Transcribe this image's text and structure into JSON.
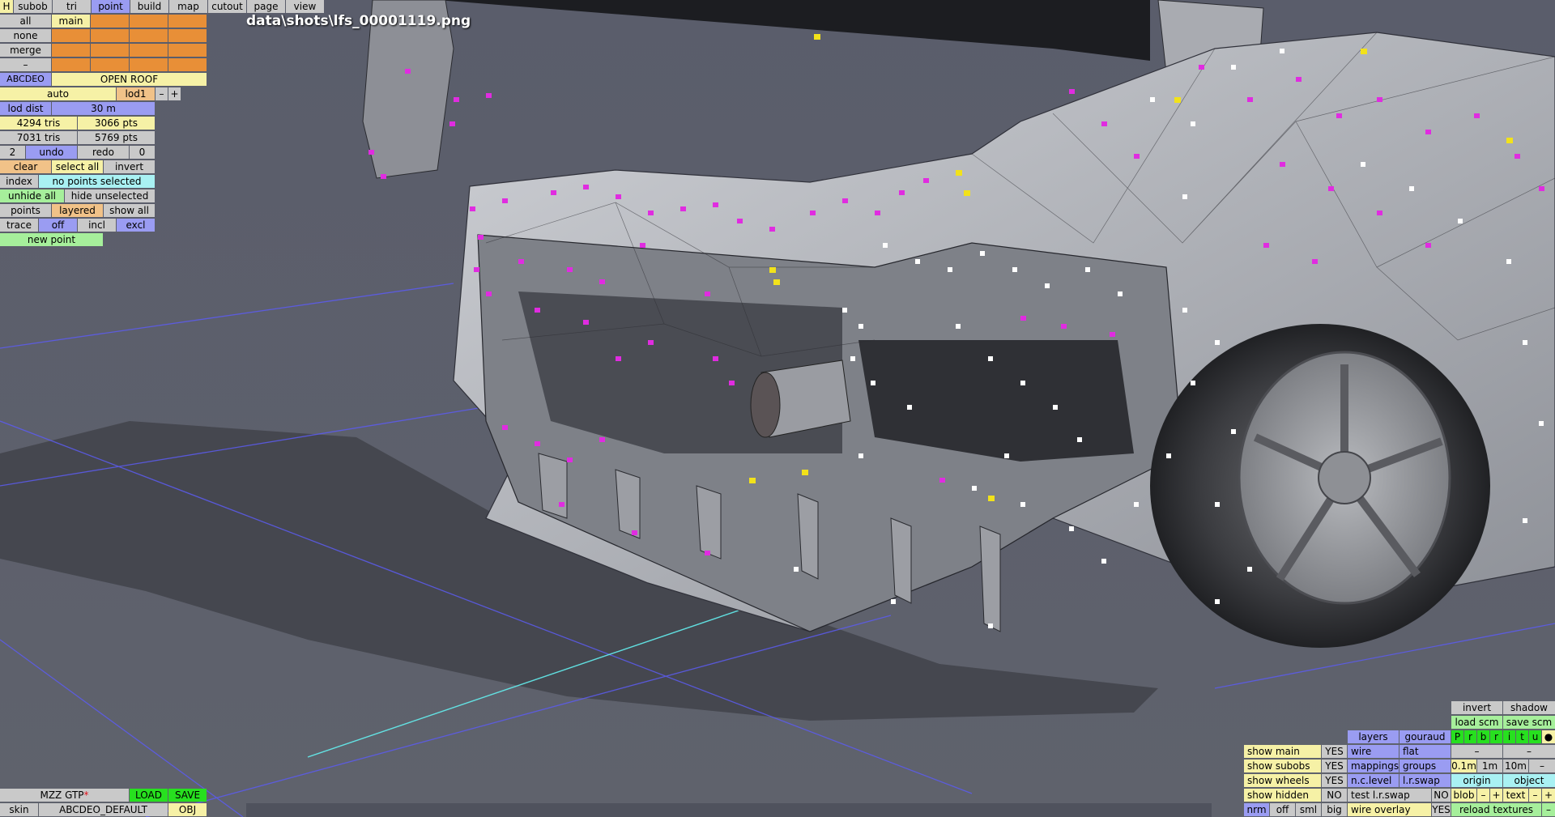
{
  "menu": {
    "h": "H",
    "tabs": [
      "subob",
      "tri",
      "point",
      "build",
      "map",
      "cutout",
      "page",
      "view"
    ],
    "active": "point"
  },
  "select": {
    "all": "all",
    "main": "main",
    "none": "none",
    "merge": "merge",
    "minus": "–"
  },
  "roof": {
    "code": "ABCDEO",
    "label": "OPEN ROOF"
  },
  "lod": {
    "mode": "auto",
    "level": "lod1",
    "dec": "–",
    "inc": "+",
    "dist_label": "lod dist",
    "dist_value": "30 m"
  },
  "stats": {
    "tris_a": "4294 tris",
    "pts_a": "3066 pts",
    "tris_b": "7031 tris",
    "pts_b": "5769 pts"
  },
  "history": {
    "count": "2",
    "undo": "undo",
    "redo": "redo",
    "redo_count": "0"
  },
  "edit": {
    "clear": "clear",
    "select_all": "select all",
    "invert": "invert",
    "index": "index",
    "selection_status": "no points selected",
    "unhide_all": "unhide all",
    "hide_unselected": "hide unselected",
    "points": "points",
    "layered": "layered",
    "show_all": "show all",
    "trace": "trace",
    "off": "off",
    "incl": "incl",
    "excl": "excl",
    "new_point": "new point"
  },
  "screenshot_path": "data\\shots\\lfs_00001119.png",
  "car": {
    "name": "MZZ GTP",
    "modified_marker": "*",
    "load": "LOAD",
    "save": "SAVE",
    "skin_label": "skin",
    "skin_value": "ABCDEO_DEFAULT",
    "obj": "OBJ"
  },
  "display": {
    "invert": "invert",
    "shadow": "shadow",
    "load_scm": "load scm",
    "save_scm": "save scm",
    "layers": "layers",
    "gouraud": "gouraud",
    "rgb_letters": [
      "P",
      "r",
      "b",
      "r",
      "i",
      "t",
      "u",
      "●"
    ],
    "show_main": "show main",
    "show_main_val": "YES",
    "wire": "wire",
    "flat": "flat",
    "show_subobs": "show subobs",
    "show_subobs_val": "YES",
    "mappings": "mappings",
    "groups": "groups",
    "grid_01": "0.1m",
    "grid_1": "1m",
    "grid_10": "10m",
    "grid_minus": "–",
    "grid_dash": "–",
    "show_wheels": "show wheels",
    "show_wheels_val": "YES",
    "nclevel": "n.c.level",
    "lrswap": "l.r.swap",
    "origin": "origin",
    "object": "object",
    "show_hidden": "show hidden",
    "show_hidden_val": "NO",
    "test_lrswap": "test l.r.swap",
    "test_lrswap_val": "NO",
    "blob": "blob",
    "blob_minus": "–",
    "blob_plus": "+",
    "text": "text",
    "text_minus": "–",
    "text_plus": "+",
    "nrm": "nrm",
    "off": "off",
    "sml": "sml",
    "big": "big",
    "wire_overlay": "wire overlay",
    "wire_overlay_val": "YES",
    "reload_textures": "reload textures",
    "reload_minus": "–"
  },
  "colors": {
    "selected_point": "#e02ce0",
    "vertex": "#ffffff",
    "highlight": "#f2e21a",
    "background": "#585b68",
    "axis_line": "#5c5cf0"
  }
}
